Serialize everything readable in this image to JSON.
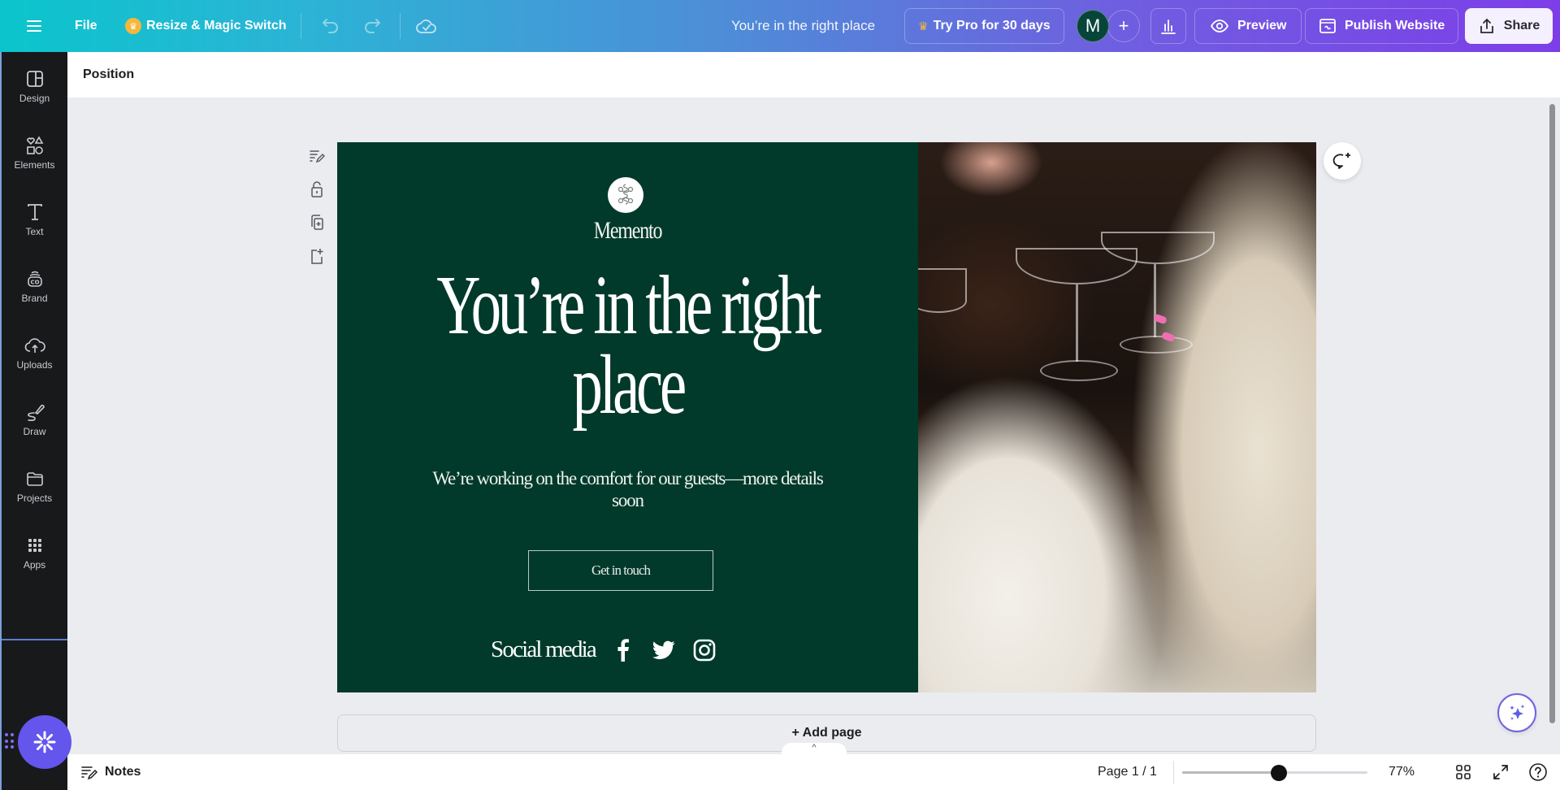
{
  "topbar": {
    "menu_icon": "hamburger-icon",
    "file_label": "File",
    "resize_label": "Resize & Magic Switch",
    "resize_icon": "crown-icon",
    "undo_icon": "undo-icon",
    "redo_icon": "redo-icon",
    "save_status_icon": "cloud-check-icon",
    "document_title": "You’re in the right place",
    "try_pro_label": "Try Pro for 30 days",
    "avatar_initial": "M",
    "add_collaborator_label": "+",
    "insights_icon": "bar-chart-icon",
    "preview_label": "Preview",
    "publish_label": "Publish Website",
    "share_label": "Share",
    "colors": {
      "gradient_start": "#0bc5cc",
      "gradient_end": "#7d3ee8",
      "avatar_bg": "#07453a"
    }
  },
  "sidebar": {
    "items": [
      {
        "label": "Design",
        "icon": "layout-icon"
      },
      {
        "label": "Elements",
        "icon": "shapes-icon"
      },
      {
        "label": "Text",
        "icon": "text-icon"
      },
      {
        "label": "Brand",
        "icon": "brand-icon"
      },
      {
        "label": "Uploads",
        "icon": "cloud-upload-icon"
      },
      {
        "label": "Draw",
        "icon": "draw-icon"
      },
      {
        "label": "Projects",
        "icon": "folder-icon"
      },
      {
        "label": "Apps",
        "icon": "apps-grid-icon"
      }
    ],
    "magic_button_icon": "sparkle-burst-icon"
  },
  "context_bar": {
    "position_label": "Position"
  },
  "page_tools": [
    "notes-edit-icon",
    "unlock-icon",
    "duplicate-page-icon",
    "add-page-icon"
  ],
  "design": {
    "brand_name": "Memento",
    "headline_line1": "You’re in the right",
    "headline_line2": "place",
    "subtext": "We’re working on the comfort for our guests—more details soon",
    "cta_label": "Get in touch",
    "social_label": "Social media",
    "social_icons": [
      "facebook-icon",
      "twitter-icon",
      "instagram-icon"
    ],
    "colors": {
      "background": "#013a2a",
      "text": "#ffffff"
    }
  },
  "canvas": {
    "add_page_label": "+ Add page",
    "collapse_label": "^",
    "comment_icon": "add-comment-icon",
    "magic_assistant_icon": "sparkles-icon"
  },
  "footer": {
    "notes_label": "Notes",
    "page_indicator": "Page 1 / 1",
    "zoom_value": 77,
    "zoom_label": "77%",
    "zoom_slider_fraction": 0.52,
    "grid_view_icon": "grid-view-icon",
    "fullscreen_icon": "fullscreen-icon",
    "help_icon": "help-icon"
  }
}
